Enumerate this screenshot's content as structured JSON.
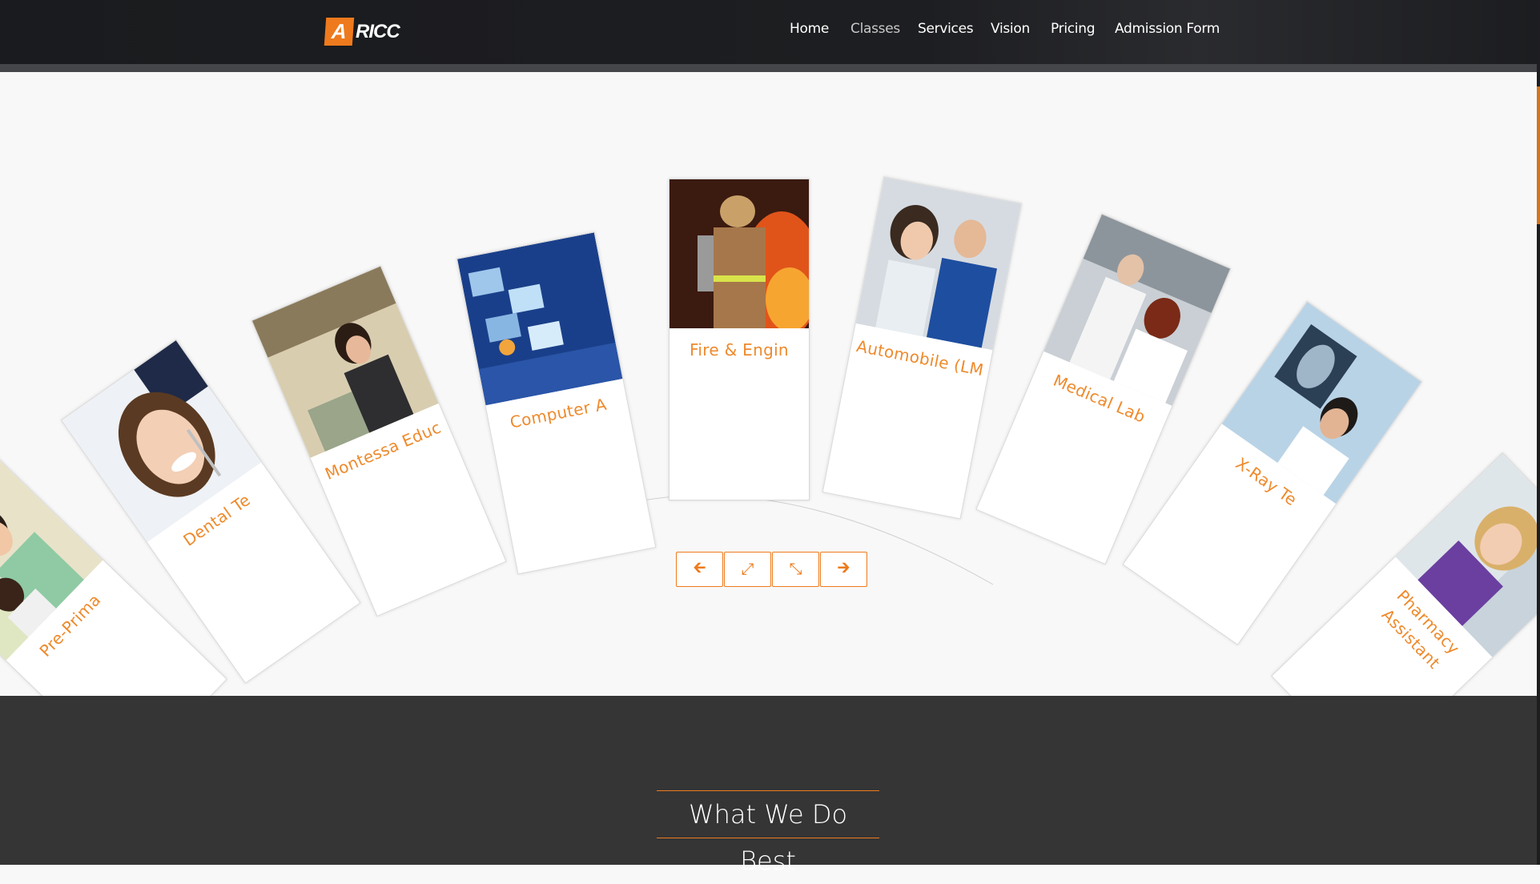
{
  "brand": {
    "mark": "A",
    "name": "RICC"
  },
  "nav": [
    {
      "label": "Home"
    },
    {
      "label": "Classes"
    },
    {
      "label": "Services"
    },
    {
      "label": "Vision"
    },
    {
      "label": "Pricing"
    },
    {
      "label": "Admission Form"
    }
  ],
  "cards": [
    {
      "title": "Pre-Prima",
      "photo": "mother-and-child-reading"
    },
    {
      "title": "Dental Te",
      "photo": "smiling-dental-patient"
    },
    {
      "title": "Montessa Educ",
      "photo": "woman-working-at-table"
    },
    {
      "title": "Computer A",
      "photo": "floating-digital-screens"
    },
    {
      "title": "Fire & Engin",
      "photo": "firefighter-in-flames"
    },
    {
      "title": "Automobile (LM",
      "photo": "couple-with-mechanic"
    },
    {
      "title": "Medical Lab",
      "photo": "lab-technicians"
    },
    {
      "title": "X-Ray Te",
      "photo": "doctor-reading-xray"
    },
    {
      "title": "Pharmacy Assistant",
      "photo": "smiling-pharmacy-assistant"
    }
  ],
  "controls": [
    {
      "icon": "arrow-left-icon",
      "glyph": "🡰"
    },
    {
      "icon": "expand-icon",
      "glyph": "⤢"
    },
    {
      "icon": "compress-icon",
      "glyph": "⤡"
    },
    {
      "icon": "arrow-right-icon",
      "glyph": "🡲"
    }
  ],
  "section": {
    "title": "What We Do Best"
  },
  "colors": {
    "accent": "#ee7a1d",
    "header": "#1b1c1f",
    "footer": "#353535"
  }
}
